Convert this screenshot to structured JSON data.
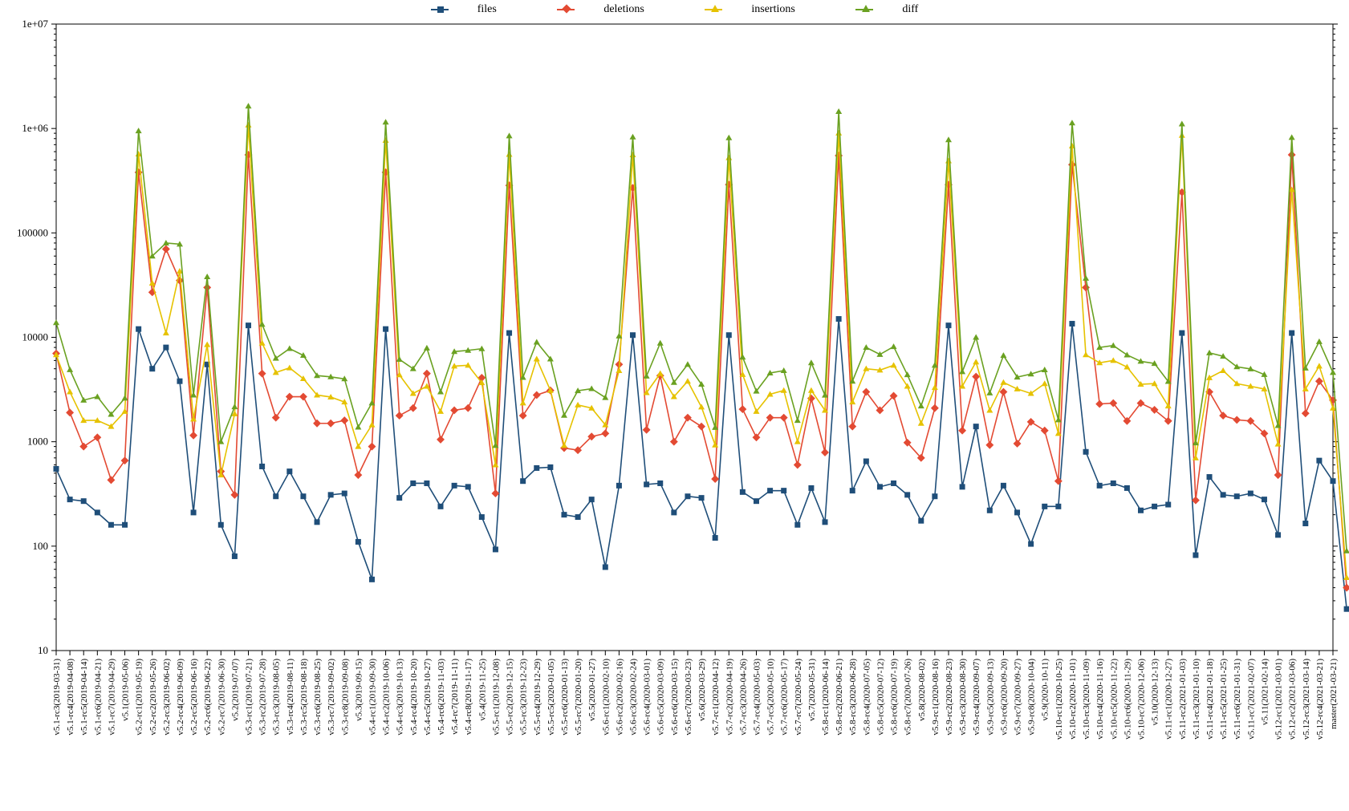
{
  "legend": [
    "files",
    "deletions",
    "insertions",
    "diff"
  ],
  "colors": {
    "files": "#1f4e79",
    "deletions": "#e34a33",
    "insertions": "#e6c200",
    "diff": "#6aa121"
  },
  "chart_data": {
    "type": "line",
    "ylabel": "",
    "xlabel": "",
    "yscale": "log",
    "ylim": [
      10,
      10000000
    ],
    "yticks": [
      10,
      100,
      1000,
      10000,
      100000,
      1000000,
      10000000
    ],
    "ytick_labels": [
      "10",
      "100",
      "1000",
      "10000",
      "100000",
      "1e+06",
      "1e+07"
    ],
    "categories": [
      "v5.1-rc3(2019-03-31)",
      "v5.1-rc4(2019-04-08)",
      "v5.1-rc5(2019-04-14)",
      "v5.1-rc6(2019-04-21)",
      "v5.1-rc7(2019-04-29)",
      "v5.1(2019-05-06)",
      "v5.2-rc1(2019-05-19)",
      "v5.2-rc2(2019-05-26)",
      "v5.2-rc3(2019-06-02)",
      "v5.2-rc4(2019-06-09)",
      "v5.2-rc5(2019-06-16)",
      "v5.2-rc6(2019-06-22)",
      "v5.2-rc7(2019-06-30)",
      "v5.2(2019-07-07)",
      "v5.3-rc1(2019-07-21)",
      "v5.3-rc2(2019-07-28)",
      "v5.3-rc3(2019-08-05)",
      "v5.3-rc4(2019-08-11)",
      "v5.3-rc5(2019-08-18)",
      "v5.3-rc6(2019-08-25)",
      "v5.3-rc7(2019-09-02)",
      "v5.3-rc8(2019-09-08)",
      "v5.3(2019-09-15)",
      "v5.4-rc1(2019-09-30)",
      "v5.4-rc2(2019-10-06)",
      "v5.4-rc3(2019-10-13)",
      "v5.4-rc4(2019-10-20)",
      "v5.4-rc5(2019-10-27)",
      "v5.4-rc6(2019-11-03)",
      "v5.4-rc7(2019-11-11)",
      "v5.4-rc8(2019-11-17)",
      "v5.4(2019-11-25)",
      "v5.5-rc1(2019-12-08)",
      "v5.5-rc2(2019-12-15)",
      "v5.5-rc3(2019-12-23)",
      "v5.5-rc4(2019-12-29)",
      "v5.5-rc5(2020-01-05)",
      "v5.5-rc6(2020-01-13)",
      "v5.5-rc7(2020-01-20)",
      "v5.5(2020-01-27)",
      "v5.6-rc1(2020-02-10)",
      "v5.6-rc2(2020-02-16)",
      "v5.6-rc3(2020-02-24)",
      "v5.6-rc4(2020-03-01)",
      "v5.6-rc5(2020-03-09)",
      "v5.6-rc6(2020-03-15)",
      "v5.6-rc7(2020-03-23)",
      "v5.6(2020-03-29)",
      "v5.7-rc1(2020-04-12)",
      "v5.7-rc2(2020-04-19)",
      "v5.7-rc3(2020-04-26)",
      "v5.7-rc4(2020-05-03)",
      "v5.7-rc5(2020-05-10)",
      "v5.7-rc6(2020-05-17)",
      "v5.7-rc7(2020-05-24)",
      "v5.7(2020-05-31)",
      "v5.8-rc1(2020-06-14)",
      "v5.8-rc2(2020-06-21)",
      "v5.8-rc3(2020-06-28)",
      "v5.8-rc4(2020-07-05)",
      "v5.8-rc5(2020-07-12)",
      "v5.8-rc6(2020-07-19)",
      "v5.8-rc7(2020-07-26)",
      "v5.8(2020-08-02)",
      "v5.9-rc1(2020-08-16)",
      "v5.9-rc2(2020-08-23)",
      "v5.9-rc3(2020-08-30)",
      "v5.9-rc4(2020-09-07)",
      "v5.9-rc5(2020-09-13)",
      "v5.9-rc6(2020-09-20)",
      "v5.9-rc7(2020-09-27)",
      "v5.9-rc8(2020-10-04)",
      "v5.9(2020-10-11)",
      "v5.10-rc1(2020-10-25)",
      "v5.10-rc2(2020-11-01)",
      "v5.10-rc3(2020-11-09)",
      "v5.10-rc4(2020-11-16)",
      "v5.10-rc5(2020-11-22)",
      "v5.10-rc6(2020-11-29)",
      "v5.10-rc7(2020-12-06)",
      "v5.10(2020-12-13)",
      "v5.11-rc1(2020-12-27)",
      "v5.11-rc2(2021-01-03)",
      "v5.11-rc3(2021-01-10)",
      "v5.11-rc4(2021-01-18)",
      "v5.11-rc5(2021-01-25)",
      "v5.11-rc6(2021-01-31)",
      "v5.11-rc7(2021-02-07)",
      "v5.11(2021-02-14)",
      "v5.12-rc1(2021-03-01)",
      "v5.12-rc2(2021-03-06)",
      "v5.12-rc3(2021-03-14)",
      "v5.12-rc4(2021-03-21)",
      "master(2021-03-21)"
    ],
    "series": [
      {
        "name": "files",
        "values": [
          550,
          280,
          270,
          210,
          160,
          160,
          12000,
          5000,
          8000,
          3800,
          210,
          5500,
          160,
          80,
          13000,
          580,
          300,
          520,
          300,
          170,
          310,
          320,
          110,
          48,
          12000,
          290,
          400,
          400,
          240,
          380,
          370,
          190,
          93,
          11000,
          420,
          560,
          570,
          200,
          190,
          280,
          63,
          380,
          10500,
          390,
          400,
          210,
          300,
          290,
          120,
          10500,
          330,
          270,
          340,
          340,
          160,
          360,
          170,
          15000,
          340,
          650,
          370,
          400,
          310,
          175,
          300,
          13000,
          370,
          1400,
          220,
          380,
          210,
          105,
          240,
          240,
          13500,
          800,
          380,
          400,
          360,
          220,
          240,
          250,
          11000,
          82,
          460,
          310,
          300,
          320,
          280,
          128,
          11000,
          165,
          660,
          420,
          25
        ]
      },
      {
        "name": "deletions",
        "values": [
          7000,
          1900,
          900,
          1100,
          430,
          660,
          380000,
          27000,
          70000,
          35000,
          1150,
          30000,
          520,
          310,
          560000,
          4500,
          1700,
          2700,
          2700,
          1500,
          1500,
          1600,
          480,
          900,
          380000,
          1780,
          2100,
          4500,
          1050,
          2000,
          2100,
          4100,
          320,
          285000,
          1780,
          2800,
          3100,
          870,
          830,
          1120,
          1200,
          5500,
          270000,
          1300,
          4300,
          1000,
          1700,
          1400,
          440,
          290000,
          2050,
          1100,
          1700,
          1700,
          600,
          2600,
          790,
          550000,
          1400,
          3000,
          2000,
          2750,
          980,
          700,
          2100,
          290000,
          1280,
          4200,
          930,
          3000,
          960,
          1550,
          1280,
          420,
          450000,
          30000,
          2300,
          2340,
          1580,
          2340,
          2020,
          1580,
          245000,
          275,
          3000,
          1780,
          1620,
          1580,
          1200,
          480,
          560000,
          1870,
          3800,
          2500,
          40
        ]
      },
      {
        "name": "insertions",
        "values": [
          6800,
          3000,
          1600,
          1600,
          1400,
          1950,
          570000,
          33000,
          11000,
          43000,
          1650,
          8500,
          480,
          1850,
          1080000,
          8800,
          4600,
          5100,
          4020,
          2800,
          2680,
          2400,
          900,
          1450,
          770000,
          4370,
          2900,
          3400,
          1950,
          5300,
          5400,
          3670,
          600,
          565000,
          2350,
          6200,
          3100,
          920,
          2250,
          2100,
          1450,
          4800,
          560000,
          2950,
          4500,
          2700,
          3800,
          2150,
          930,
          525000,
          4400,
          1950,
          2850,
          3100,
          1000,
          3100,
          2000,
          903000,
          2400,
          5000,
          4850,
          5400,
          3400,
          1500,
          3300,
          490000,
          3400,
          5800,
          2000,
          3700,
          3200,
          2900,
          3600,
          1200,
          680000,
          6800,
          5700,
          6000,
          5200,
          3550,
          3600,
          2200,
          860000,
          700,
          4100,
          4800,
          3600,
          3400,
          3200,
          950,
          260000,
          3200,
          5300,
          2100,
          50
        ]
      },
      {
        "name": "diff",
        "values": [
          13800,
          4900,
          2500,
          2700,
          1830,
          2610,
          950000,
          60000,
          80000,
          78000,
          2800,
          38000,
          1000,
          2160,
          1640000,
          13300,
          6300,
          7800,
          6720,
          4300,
          4180,
          4000,
          1380,
          2350,
          1150000,
          6150,
          5000,
          7900,
          3000,
          7300,
          7500,
          7770,
          920,
          850000,
          4130,
          9000,
          6200,
          1790,
          3080,
          3220,
          2650,
          10300,
          830000,
          4250,
          8800,
          3700,
          5500,
          3550,
          1370,
          815000,
          6450,
          3050,
          4550,
          4800,
          1600,
          5700,
          2790,
          1453000,
          3800,
          8000,
          6850,
          8150,
          4380,
          2200,
          5400,
          780000,
          4680,
          10000,
          2930,
          6700,
          4160,
          4450,
          4880,
          1620,
          1130000,
          36800,
          8000,
          8340,
          6780,
          5890,
          5620,
          3780,
          1105000,
          975,
          7100,
          6580,
          5220,
          4980,
          4400,
          1430,
          820000,
          5070,
          9100,
          4600,
          90
        ]
      }
    ]
  }
}
